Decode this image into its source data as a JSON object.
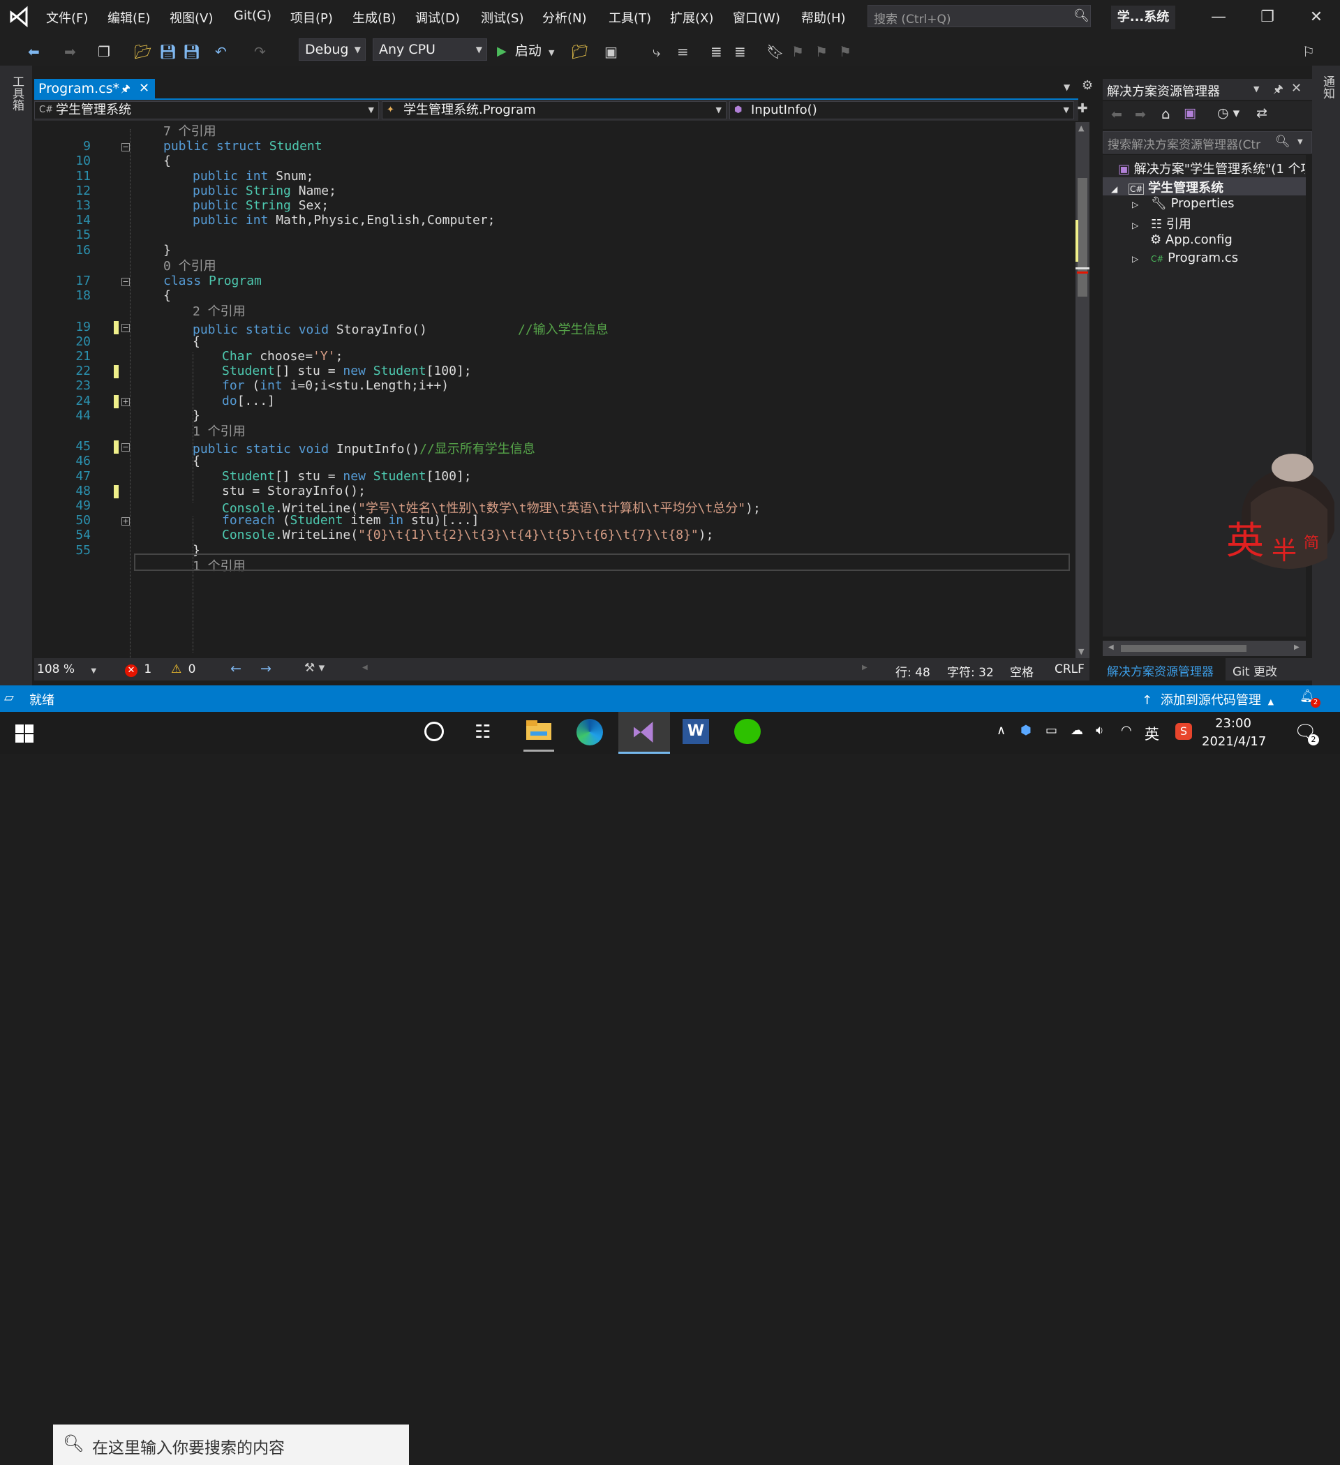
{
  "titlebar": {
    "menus": [
      "文件(F)",
      "编辑(E)",
      "视图(V)",
      "Git(G)",
      "项目(P)",
      "生成(B)",
      "调试(D)",
      "测试(S)",
      "分析(N)",
      "工具(T)",
      "扩展(X)",
      "窗口(W)",
      "帮助(H)"
    ],
    "search_placeholder": "搜索 (Ctrl+Q)",
    "solution_name": "学...系统"
  },
  "toolbar": {
    "config": "Debug",
    "platform": "Any CPU",
    "start_label": "启动"
  },
  "left_strip": {
    "toolbox_label": "工具箱"
  },
  "right_strip": {
    "notifications_label": "通知"
  },
  "doc_tab": {
    "label": "Program.cs*"
  },
  "navbar": {
    "project": "学生管理系统",
    "class": "学生管理系统.Program",
    "member": "InputInfo()"
  },
  "code": {
    "lines": [
      {
        "type": "lens",
        "text": "7 个引用",
        "indent": 0
      },
      {
        "type": "code",
        "num": "9",
        "indent": 0,
        "tokens": [
          [
            "kw",
            "public "
          ],
          [
            "kw",
            "struct "
          ],
          [
            "ty",
            "Student"
          ]
        ],
        "fold": "minus"
      },
      {
        "type": "code",
        "num": "10",
        "indent": 0,
        "tokens": [
          [
            "",
            "{"
          ]
        ]
      },
      {
        "type": "code",
        "num": "11",
        "indent": 1,
        "tokens": [
          [
            "kw",
            "public "
          ],
          [
            "kw",
            "int "
          ],
          [
            "",
            "Snum;"
          ]
        ]
      },
      {
        "type": "code",
        "num": "12",
        "indent": 1,
        "tokens": [
          [
            "kw",
            "public "
          ],
          [
            "ty",
            "String "
          ],
          [
            "",
            "Name;"
          ]
        ]
      },
      {
        "type": "code",
        "num": "13",
        "indent": 1,
        "tokens": [
          [
            "kw",
            "public "
          ],
          [
            "ty",
            "String "
          ],
          [
            "",
            "Sex;"
          ]
        ]
      },
      {
        "type": "code",
        "num": "14",
        "indent": 1,
        "tokens": [
          [
            "kw",
            "public "
          ],
          [
            "kw",
            "int "
          ],
          [
            "",
            "Math,Physic,English,Computer;"
          ]
        ]
      },
      {
        "type": "code",
        "num": "15",
        "indent": 1,
        "tokens": []
      },
      {
        "type": "code",
        "num": "16",
        "indent": 0,
        "tokens": [
          [
            "",
            "}"
          ]
        ]
      },
      {
        "type": "lens",
        "text": "0 个引用",
        "indent": 0
      },
      {
        "type": "code",
        "num": "17",
        "indent": 0,
        "tokens": [
          [
            "kw",
            "class "
          ],
          [
            "ty",
            "Program"
          ]
        ],
        "fold": "minus"
      },
      {
        "type": "code",
        "num": "18",
        "indent": 0,
        "tokens": [
          [
            "",
            "{"
          ]
        ]
      },
      {
        "type": "lens",
        "text": "2 个引用",
        "indent": 1
      },
      {
        "type": "code",
        "num": "19",
        "indent": 1,
        "tokens": [
          [
            "kw",
            "public "
          ],
          [
            "kw",
            "static "
          ],
          [
            "kw",
            "void "
          ],
          [
            "",
            "StorayInfo()            "
          ],
          [
            "cm",
            "//输入学生信息"
          ]
        ],
        "fold": "minus",
        "changed": true
      },
      {
        "type": "code",
        "num": "20",
        "indent": 1,
        "tokens": [
          [
            "",
            "{"
          ]
        ]
      },
      {
        "type": "code",
        "num": "21",
        "indent": 2,
        "tokens": [
          [
            "ty",
            "Char "
          ],
          [
            "",
            "choose="
          ],
          [
            "str",
            "'Y'"
          ],
          [
            "",
            ";"
          ]
        ]
      },
      {
        "type": "code",
        "num": "22",
        "indent": 2,
        "tokens": [
          [
            "ty",
            "Student"
          ],
          [
            "",
            "[] stu = "
          ],
          [
            "kw",
            "new "
          ],
          [
            "ty",
            "Student"
          ],
          [
            "",
            "[100];"
          ]
        ],
        "changed": true
      },
      {
        "type": "code",
        "num": "23",
        "indent": 2,
        "tokens": [
          [
            "kw",
            "for "
          ],
          [
            "",
            "("
          ],
          [
            "kw",
            "int "
          ],
          [
            "",
            "i=0;i<stu.Length;i++)"
          ]
        ]
      },
      {
        "type": "code",
        "num": "24",
        "indent": 2,
        "tokens": [
          [
            "kw",
            "do"
          ],
          [
            "",
            "[...]"
          ]
        ],
        "fold": "plus",
        "changed": true
      },
      {
        "type": "code",
        "num": "44",
        "indent": 1,
        "tokens": [
          [
            "",
            "}"
          ]
        ]
      },
      {
        "type": "lens",
        "text": "1 个引用",
        "indent": 1
      },
      {
        "type": "code",
        "num": "45",
        "indent": 1,
        "tokens": [
          [
            "kw",
            "public "
          ],
          [
            "kw",
            "static "
          ],
          [
            "kw",
            "void "
          ],
          [
            "",
            "InputInfo()"
          ],
          [
            "cm",
            "//显示所有学生信息"
          ]
        ],
        "fold": "minus",
        "changed": true
      },
      {
        "type": "code",
        "num": "46",
        "indent": 1,
        "tokens": [
          [
            "",
            "{"
          ]
        ]
      },
      {
        "type": "code",
        "num": "47",
        "indent": 2,
        "tokens": [
          [
            "ty",
            "Student"
          ],
          [
            "",
            "[] stu = "
          ],
          [
            "kw",
            "new "
          ],
          [
            "ty",
            "Student"
          ],
          [
            "",
            "[100];"
          ]
        ]
      },
      {
        "type": "code",
        "num": "48",
        "indent": 2,
        "tokens": [
          [
            "",
            "stu = StorayInfo();"
          ]
        ],
        "changed": true
      },
      {
        "type": "code",
        "num": "49",
        "indent": 2,
        "tokens": [
          [
            "ty",
            "Console"
          ],
          [
            "",
            ".WriteLine("
          ],
          [
            "str",
            "\"学号\\t姓名\\t性别\\t数学\\t物理\\t英语\\t计算机\\t平均分\\t总分\""
          ],
          [
            "",
            ");"
          ]
        ]
      },
      {
        "type": "code",
        "num": "50",
        "indent": 2,
        "tokens": [
          [
            "kw",
            "foreach "
          ],
          [
            "",
            "("
          ],
          [
            "ty",
            "Student "
          ],
          [
            "",
            "item "
          ],
          [
            "kw",
            "in "
          ],
          [
            "",
            "stu)[...]"
          ]
        ],
        "fold": "plus"
      },
      {
        "type": "code",
        "num": "54",
        "indent": 2,
        "tokens": [
          [
            "ty",
            "Console"
          ],
          [
            "",
            ".WriteLine("
          ],
          [
            "str",
            "\"{0}\\t{1}\\t{2}\\t{3}\\t{4}\\t{5}\\t{6}\\t{7}\\t{8}\""
          ],
          [
            "",
            ");"
          ]
        ]
      },
      {
        "type": "code",
        "num": "55",
        "indent": 1,
        "tokens": [
          [
            "",
            "}"
          ]
        ]
      },
      {
        "type": "lens",
        "text": "1 个引用",
        "indent": 1
      }
    ]
  },
  "editor_status": {
    "zoom": "108 %",
    "errors": "1",
    "warnings": "0",
    "line": "行: 48",
    "char": "字符: 32",
    "spaces": "空格",
    "eol": "CRLF"
  },
  "solution_explorer": {
    "title": "解决方案资源管理器",
    "search_placeholder": "搜索解决方案资源管理器(Ctr",
    "solution_node": "解决方案\"学生管理系统\"(1 个项",
    "project_node": "学生管理系统",
    "items": [
      "Properties",
      "引用",
      "App.config",
      "Program.cs"
    ],
    "tabs": [
      "解决方案资源管理器",
      "Git 更改"
    ]
  },
  "statusbar": {
    "ready": "就绪",
    "source_control": "添加到源代码管理",
    "notif_count": "2"
  },
  "taskbar": {
    "search_placeholder": "在这里输入你要搜索的内容",
    "ime_lang": "英",
    "time": "23:00",
    "date": "2021/4/17",
    "notif_count": "2"
  },
  "overlay": {
    "ime_char1": "英",
    "ime_char2": "半",
    "ime_char3": "简"
  },
  "colors": {
    "accent": "#007acc",
    "keyword": "#569cd6",
    "type": "#4ec9b0",
    "string": "#d69d85",
    "comment": "#57a64a",
    "line_number": "#2b91af",
    "change_marker": "#efef8a"
  }
}
